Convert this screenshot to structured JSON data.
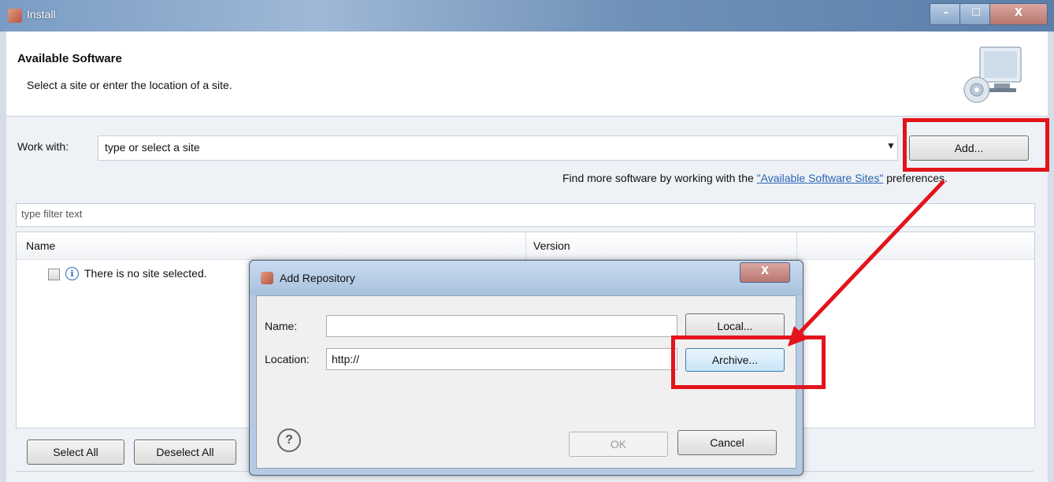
{
  "window": {
    "title": "Install",
    "controls": [
      "–",
      "☐",
      "X"
    ]
  },
  "header": {
    "title": "Available Software",
    "subtitle": "Select a site or enter the location of a site."
  },
  "work_with": {
    "label": "Work with:",
    "value": "type or select a site",
    "add_button": "Add...",
    "hint_prefix": "Find more software by working with the ",
    "hint_link": "\"Available Software Sites\"",
    "hint_suffix": " preferences."
  },
  "filter": {
    "placeholder": "type filter text"
  },
  "table": {
    "columns": [
      "Name",
      "Version"
    ],
    "rows": [
      {
        "text": "There is no site selected."
      }
    ]
  },
  "buttons": {
    "select_all": "Select All",
    "deselect_all": "Deselect All"
  },
  "dialog": {
    "title": "Add Repository",
    "close": "X",
    "name_label": "Name:",
    "name_value": "",
    "location_label": "Location:",
    "location_value": "http://",
    "local_button": "Local...",
    "archive_button": "Archive...",
    "ok_button": "OK",
    "cancel_button": "Cancel",
    "help_icon": "?"
  },
  "annotation_color": "#e3141c"
}
